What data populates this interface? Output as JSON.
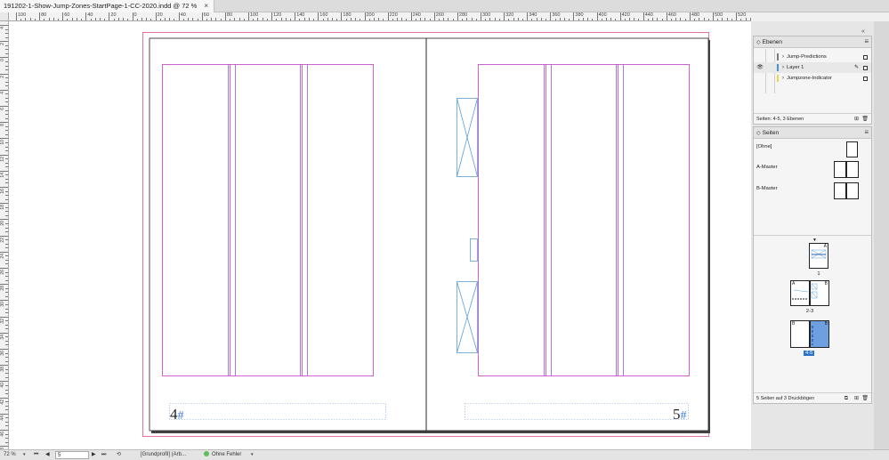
{
  "document": {
    "tab_title": "191202-1-Show-Jump-Zones-StartPage-1-CC-2020.indd @ 72 %",
    "close_glyph": "×"
  },
  "ruler": {
    "h_labels": [
      "100",
      "80",
      "60",
      "40",
      "20",
      "0",
      "20",
      "40",
      "60",
      "80",
      "100",
      "120",
      "140",
      "160",
      "180",
      "200",
      "220",
      "240",
      "260",
      "280",
      "300",
      "320",
      "340",
      "360",
      "380",
      "400",
      "420",
      "440",
      "460",
      "480",
      "500",
      "520",
      "540"
    ],
    "v_labels": [
      "4",
      "2",
      "0",
      "2",
      "4",
      "6",
      "8",
      "10",
      "12",
      "14",
      "16",
      "18",
      "20",
      "22",
      "24",
      "26",
      "28",
      "30",
      "32",
      "34",
      "36",
      "38",
      "40",
      "42",
      "44",
      "46",
      "48"
    ]
  },
  "spread": {
    "left_page_number": "4",
    "right_page_number": "5",
    "page_marker_glyph": "#"
  },
  "layers_panel": {
    "title": "Ebenen",
    "menu_glyph": "≡",
    "layers": [
      {
        "name": "Jump-Predictions",
        "color": "#7a7a7a",
        "visible": false,
        "active": false
      },
      {
        "name": "Layer 1",
        "color": "#4a90d9",
        "visible": true,
        "active": true
      },
      {
        "name": "Jumpzone-Indicator",
        "color": "#e8d84a",
        "visible": false,
        "active": false
      }
    ],
    "footer": "Seiten: 4-5, 3 Ebenen",
    "eye_glyph": "👁",
    "pen_glyph": "✎"
  },
  "pages_panel": {
    "title": "Seiten",
    "menu_glyph": "≡",
    "masters": [
      "[Ohne]",
      "A-Master",
      "B-Master"
    ],
    "spreads": [
      {
        "label": "1",
        "badges": [
          "A"
        ],
        "selected": false
      },
      {
        "label": "2-3",
        "badges": [
          "A",
          "B"
        ],
        "selected": false
      },
      {
        "label": "4-5",
        "badges": [
          "B",
          "B"
        ],
        "selected": true
      }
    ],
    "footer": "5 Seiten auf 3 Druckbögen"
  },
  "statusbar": {
    "zoom": "72 %",
    "page": "5",
    "profile": "[Grundprofil] (Arb...",
    "preflight": "Ohne Fehler"
  },
  "colors": {
    "margin": "#c63cc6",
    "column": "#8a5cf0",
    "frame": "#5aa0d8",
    "bleed": "#e0508c"
  }
}
